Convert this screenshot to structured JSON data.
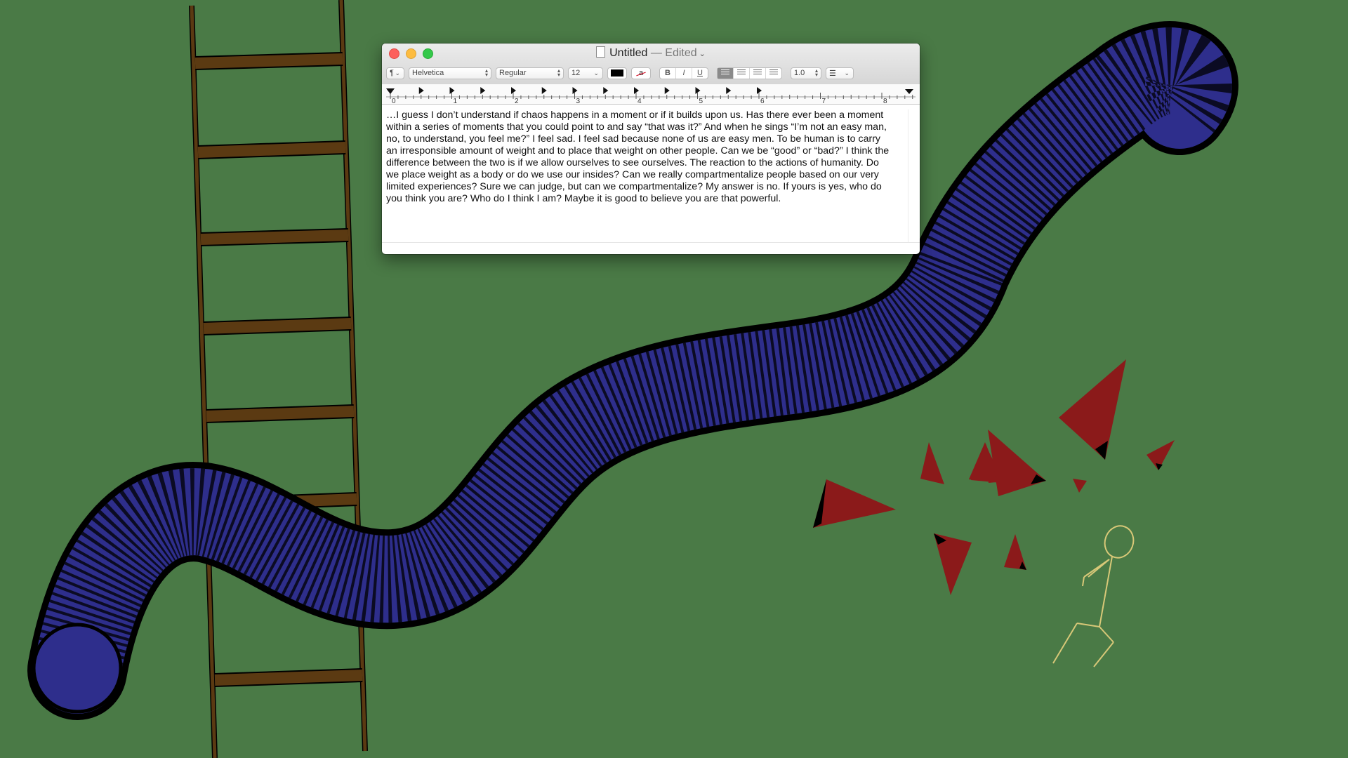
{
  "window": {
    "title": "Untitled",
    "status": "— Edited",
    "title_chevron": "⌄"
  },
  "toolbar": {
    "paragraph_menu": "¶",
    "font_family": "Helvetica",
    "font_style": "Regular",
    "font_size": "12",
    "text_color": "#000000",
    "bold_label": "B",
    "italic_label": "I",
    "underline_label": "U",
    "line_spacing": "1.0",
    "list_menu": "☰"
  },
  "ruler": {
    "labels": [
      "0",
      "1",
      "2",
      "3",
      "4",
      "5",
      "6",
      "7",
      "8"
    ]
  },
  "document": {
    "text": "…I guess I don’t understand if chaos happens in a moment or if it builds upon us. Has there ever been a moment\nwithin a series of moments that you could point to and say “that was it?” And when he sings “I’m not an easy man,\nno, to understand, you feel me?” I feel sad. I feel sad because none of us are easy men. To be human is to carry\nan irresponsible amount of weight and to place that weight on other people. Can we be “good” or “bad?” I think the\ndifference between the two is if we allow ourselves to see ourselves. The reaction to the actions of humanity. Do\nwe place weight as a body or do we use our insides? Can we really compartmentalize people based on our very\nlimited experiences? Sure we can judge, but can we compartmentalize? My answer is no. If yours is yes, who do\nyou think you are? Who do I think I am? Maybe it is good to believe you are that powerful."
  },
  "colors": {
    "background": "#4a7a46",
    "tube_fill": "#2e2e8c",
    "tube_outline": "#000000",
    "ladder": "#5b3a12",
    "shards": "#8b1a1a",
    "figure": "#d8c878"
  }
}
